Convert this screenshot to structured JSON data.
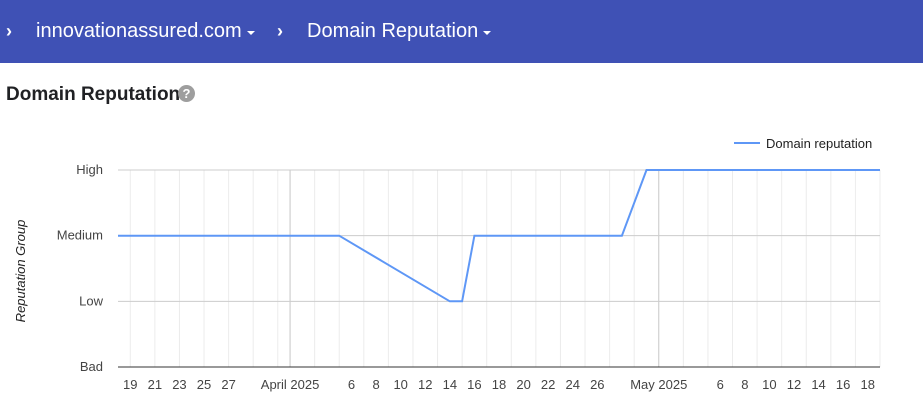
{
  "header": {
    "breadcrumb": [
      {
        "label": "innovationassured.com"
      },
      {
        "label": "Domain Reputation"
      }
    ]
  },
  "page": {
    "title": "Domain Reputation",
    "help_glyph": "?"
  },
  "colors": {
    "header_bg": "#3f51b5",
    "series": "#5e97f6"
  },
  "chart_data": {
    "type": "line",
    "title": "",
    "ylabel": "Reputation Group",
    "xlabel": "",
    "y_categories": [
      "Bad",
      "Low",
      "Medium",
      "High"
    ],
    "x_tick_labels": [
      "19",
      "21",
      "23",
      "25",
      "27",
      "April 2025",
      "6",
      "8",
      "10",
      "12",
      "14",
      "16",
      "18",
      "20",
      "22",
      "24",
      "26",
      "May 2025",
      "6",
      "8",
      "10",
      "12",
      "14",
      "16",
      "18"
    ],
    "x_tick_dates": [
      "2025-03-19",
      "2025-03-21",
      "2025-03-23",
      "2025-03-25",
      "2025-03-27",
      "2025-04-01",
      "2025-04-06",
      "2025-04-08",
      "2025-04-10",
      "2025-04-12",
      "2025-04-14",
      "2025-04-16",
      "2025-04-18",
      "2025-04-20",
      "2025-04-22",
      "2025-04-24",
      "2025-04-26",
      "2025-05-01",
      "2025-05-06",
      "2025-05-08",
      "2025-05-10",
      "2025-05-12",
      "2025-05-14",
      "2025-05-16",
      "2025-05-18"
    ],
    "x_range": [
      "2025-03-18",
      "2025-05-19"
    ],
    "grid": true,
    "legend": "top-right",
    "series": [
      {
        "name": "Domain reputation",
        "points": [
          {
            "x": "2025-03-18",
            "y": "Medium"
          },
          {
            "x": "2025-04-05",
            "y": "Medium"
          },
          {
            "x": "2025-04-14",
            "y": "Low"
          },
          {
            "x": "2025-04-15",
            "y": "Low"
          },
          {
            "x": "2025-04-16",
            "y": "Medium"
          },
          {
            "x": "2025-04-28",
            "y": "Medium"
          },
          {
            "x": "2025-04-30",
            "y": "High"
          },
          {
            "x": "2025-05-19",
            "y": "High"
          }
        ]
      }
    ]
  }
}
